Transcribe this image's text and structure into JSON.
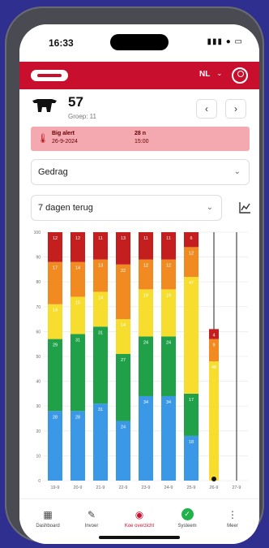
{
  "status_bar": {
    "time": "16:33",
    "icons": "▮▮▮ ● ▭"
  },
  "header": {
    "language": "NL"
  },
  "cow": {
    "number": "57",
    "group": "Groep: 11"
  },
  "alert": {
    "line1_left": "Big alert",
    "line2_left": "26-9-2024",
    "line1_right": "28 n",
    "line2_right": "15:00"
  },
  "selectors": {
    "category": "Gedrag",
    "period": "7 dagen terug"
  },
  "colors": {
    "brand": "#c8102e",
    "blue": "#3a98e6",
    "green": "#21a04a",
    "yellow": "#f6dd2e",
    "orange": "#f28a22",
    "red": "#c41e1e"
  },
  "chart_data": {
    "type": "bar",
    "stacked": true,
    "categories": [
      "19-9",
      "20-9",
      "21-9",
      "22-9",
      "23-9",
      "24-9",
      "25-9",
      "26-9",
      "27-9"
    ],
    "ylim": [
      0,
      100
    ],
    "yticks": [
      0,
      10,
      20,
      30,
      40,
      50,
      60,
      70,
      80,
      90,
      100
    ],
    "series": [
      {
        "color": "blue",
        "values": [
          28,
          28,
          31,
          24,
          34,
          34,
          18,
          0,
          0
        ]
      },
      {
        "color": "green",
        "values": [
          29,
          31,
          31,
          27,
          24,
          24,
          17,
          0,
          0
        ]
      },
      {
        "color": "yellow",
        "values": [
          14,
          15,
          14,
          14,
          19,
          19,
          47,
          48,
          0
        ]
      },
      {
        "color": "orange",
        "values": [
          17,
          14,
          13,
          22,
          12,
          12,
          12,
          9,
          0
        ]
      },
      {
        "color": "red",
        "values": [
          12,
          12,
          11,
          13,
          11,
          11,
          6,
          4,
          0
        ]
      }
    ],
    "grid": true,
    "legend": "none"
  },
  "tabs": [
    {
      "label": "Dashboard",
      "icon": "dashboard-icon"
    },
    {
      "label": "Invoer",
      "icon": "edit-icon"
    },
    {
      "label": "Koe overzicht",
      "icon": "cow-icon"
    },
    {
      "label": "Systeem",
      "icon": "check-icon"
    },
    {
      "label": "Meer",
      "icon": "more-icon"
    }
  ]
}
